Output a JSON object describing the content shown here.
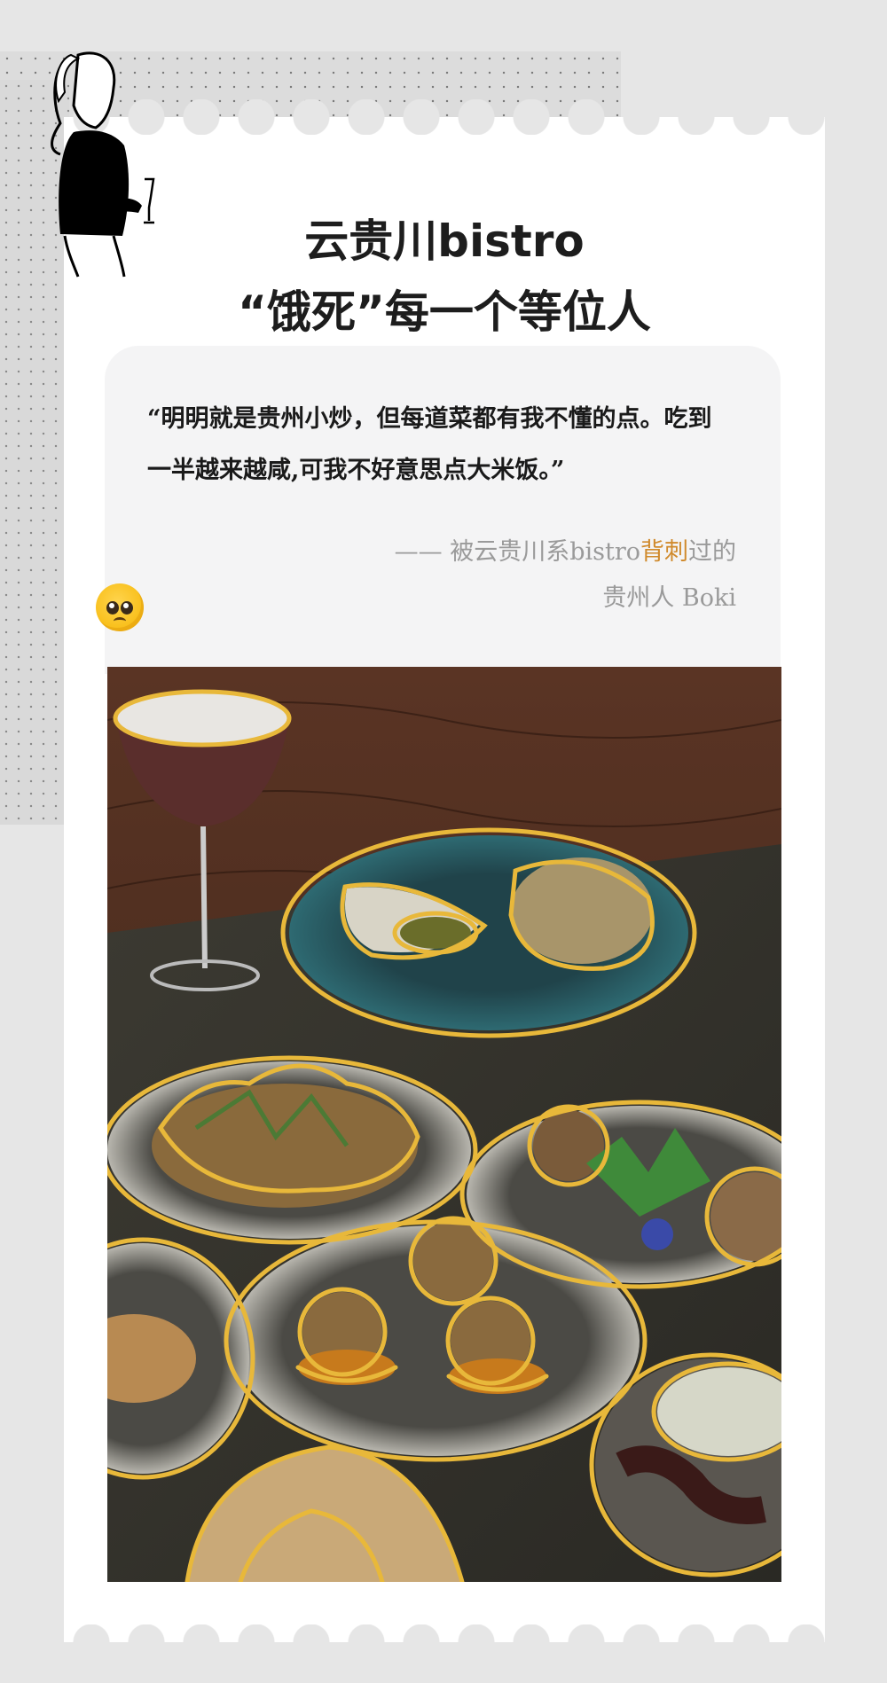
{
  "header": {
    "title_line1": "云贵川bistro",
    "title_line2": "“饿死”每一个等位人"
  },
  "quote": {
    "text": "“明明就是贵州小炒，但每道菜都有我不懂的点。吃到一半越来越咸,可我不好意思点大米饭。”",
    "attribution_prefix": "——  被云贵川系bistro",
    "attribution_highlight": "背刺",
    "attribution_suffix": "过的",
    "attribution_line2": "贵州人  Boki"
  },
  "icons": {
    "emoji": "pleading-face-icon",
    "illustration": "woman-with-wine-glass-icon"
  },
  "colors": {
    "accent": "#d08a2c",
    "outline": "#e8b83a",
    "background": "#e6e6e6",
    "card": "#ffffff"
  }
}
